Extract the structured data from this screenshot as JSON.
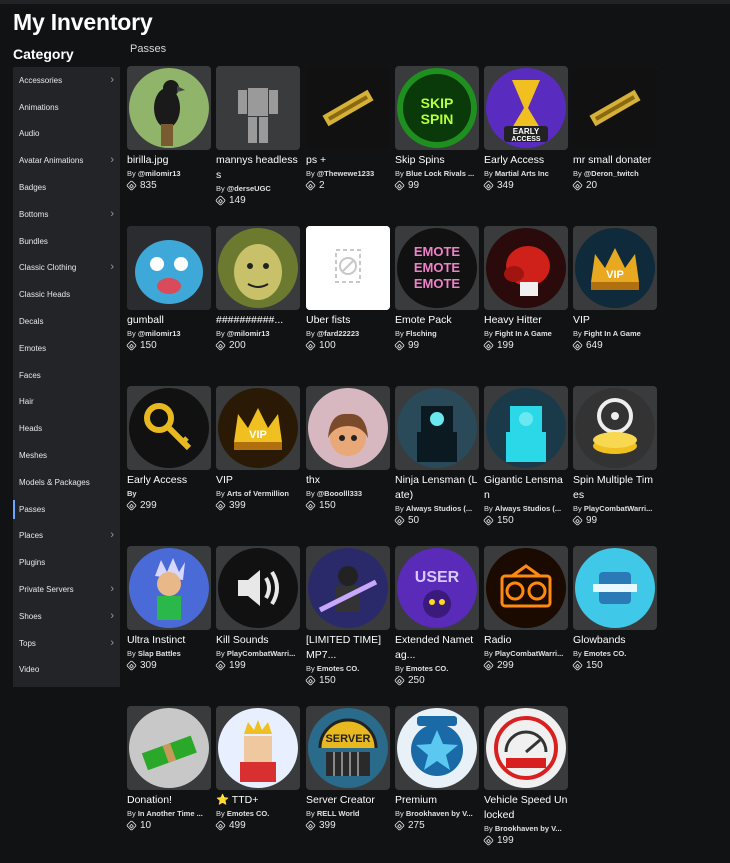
{
  "header": {
    "title": "My Inventory"
  },
  "sidebar": {
    "heading": "Category",
    "items": [
      {
        "label": "Accessories",
        "chevron": true
      },
      {
        "label": "Animations",
        "chevron": false
      },
      {
        "label": "Audio",
        "chevron": false
      },
      {
        "label": "Avatar Animations",
        "chevron": true
      },
      {
        "label": "Badges",
        "chevron": false
      },
      {
        "label": "Bottoms",
        "chevron": true
      },
      {
        "label": "Bundles",
        "chevron": false
      },
      {
        "label": "Classic Clothing",
        "chevron": true
      },
      {
        "label": "Classic Heads",
        "chevron": false
      },
      {
        "label": "Decals",
        "chevron": false
      },
      {
        "label": "Emotes",
        "chevron": false
      },
      {
        "label": "Faces",
        "chevron": false
      },
      {
        "label": "Hair",
        "chevron": false
      },
      {
        "label": "Heads",
        "chevron": false
      },
      {
        "label": "Meshes",
        "chevron": false
      },
      {
        "label": "Models & Packages",
        "chevron": false
      },
      {
        "label": "Passes",
        "chevron": false,
        "active": true
      },
      {
        "label": "Places",
        "chevron": true
      },
      {
        "label": "Plugins",
        "chevron": false
      },
      {
        "label": "Private Servers",
        "chevron": true
      },
      {
        "label": "Shoes",
        "chevron": true
      },
      {
        "label": "Tops",
        "chevron": true
      },
      {
        "label": "Video",
        "chevron": false
      }
    ]
  },
  "main": {
    "section_label": "Passes",
    "items": [
      {
        "name": "birilla.jpg",
        "by": "@milomir13",
        "price": "835",
        "icon": "crow-icon",
        "colors": [
          "#8fb46a",
          "#1a1a1a"
        ]
      },
      {
        "name": "mannys headlesss",
        "by": "@derseUGC",
        "price": "149",
        "icon": "headless-avatar-icon",
        "colors": [
          "#393b3d",
          "#9a9a9a"
        ]
      },
      {
        "name": "ps +",
        "by": "@Thewewe1233",
        "price": "2",
        "icon": "gold-ticket-icon",
        "colors": [
          "#111111",
          "#d6b13a"
        ]
      },
      {
        "name": "Skip Spins",
        "by": "Blue Lock Rivals ...",
        "price": "99",
        "icon": "skip-spin-icon",
        "colors": [
          "#1f8f1f",
          "#b8ff3a"
        ]
      },
      {
        "name": "Early Access",
        "by": "Martial Arts Inc",
        "price": "349",
        "icon": "hourglass-icon",
        "colors": [
          "#5a2bbf",
          "#ffffff"
        ]
      },
      {
        "name": "mr small donater",
        "by": "@Deron_twitch",
        "price": "20",
        "icon": "gold-ticket-icon",
        "colors": [
          "#111111",
          "#d6b13a"
        ]
      },
      {
        "name": "gumball",
        "by": "@milomir13",
        "price": "150",
        "icon": "blue-cat-face-icon",
        "colors": [
          "#3ea8d8",
          "#d94a5a"
        ]
      },
      {
        "name": "##########...",
        "by": "@milomir13",
        "price": "200",
        "icon": "ogre-face-icon",
        "colors": [
          "#6b7a2e",
          "#c9c06a"
        ]
      },
      {
        "name": "Uber fists",
        "by": "@fard22223",
        "price": "100",
        "icon": "missing-image-icon",
        "colors": [
          "#ffffff",
          "#c8c8c8"
        ]
      },
      {
        "name": "Emote Pack",
        "by": "Flsching",
        "price": "99",
        "icon": "emote-text-icon",
        "colors": [
          "#111111",
          "#f080c8"
        ]
      },
      {
        "name": "Heavy Hitter",
        "by": "Fight In A Game",
        "price": "199",
        "icon": "boxing-glove-icon",
        "colors": [
          "#2a0a0a",
          "#d0201a"
        ]
      },
      {
        "name": "VIP",
        "by": "Fight In A Game",
        "price": "649",
        "icon": "vip-crown-icon",
        "colors": [
          "#0f2a3a",
          "#e8a820"
        ]
      },
      {
        "name": "Early Access",
        "by": "By",
        "price": "299",
        "icon": "gold-key-icon",
        "colors": [
          "#111111",
          "#e8b820"
        ]
      },
      {
        "name": "VIP",
        "by": "Arts of Vermillion",
        "price": "399",
        "icon": "vip-crown-icon",
        "colors": [
          "#2a1a05",
          "#f0c020"
        ]
      },
      {
        "name": "thx",
        "by": "@Booolll333",
        "price": "150",
        "icon": "cartoon-girl-icon",
        "colors": [
          "#d8b8c0",
          "#7a4a2a"
        ]
      },
      {
        "name": "Ninja Lensman (Late)",
        "by": "Always Studios (...",
        "price": "50",
        "icon": "robot-icon",
        "colors": [
          "#2a4a5a",
          "#0a1a20"
        ]
      },
      {
        "name": "Gigantic Lensman",
        "by": "Always Studios (...",
        "price": "150",
        "icon": "robot-icon",
        "colors": [
          "#1a3a4a",
          "#2ad8e8"
        ]
      },
      {
        "name": "Spin Multiple Times",
        "by": "PlayCombatWarri...",
        "price": "99",
        "icon": "reel-coins-icon",
        "colors": [
          "#333333",
          "#f0c020"
        ]
      },
      {
        "name": "Ultra Instinct",
        "by": "Slap Battles",
        "price": "309",
        "icon": "anime-hero-icon",
        "colors": [
          "#4a6ad8",
          "#2ab84a"
        ]
      },
      {
        "name": "Kill Sounds",
        "by": "PlayCombatWarri...",
        "price": "199",
        "icon": "speaker-icon",
        "colors": [
          "#111111",
          "#e8e8e8"
        ]
      },
      {
        "name": "[LIMITED TIME] MP7...",
        "by": "Emotes CO.",
        "price": "150",
        "icon": "neon-gun-icon",
        "colors": [
          "#2a2a6a",
          "#c8a8ff"
        ]
      },
      {
        "name": "Extended Nametag...",
        "by": "Emotes CO.",
        "price": "250",
        "icon": "user-badge-icon",
        "colors": [
          "#5a2ab8",
          "#d8c8ff"
        ]
      },
      {
        "name": "Radio",
        "by": "PlayCombatWarri...",
        "price": "299",
        "icon": "radio-icon",
        "colors": [
          "#1a0a00",
          "#ff8a10"
        ]
      },
      {
        "name": "Glowbands",
        "by": "Emotes CO.",
        "price": "150",
        "icon": "glowbands-icon",
        "colors": [
          "#40c8e8",
          "#e8f8ff"
        ]
      },
      {
        "name": "Donation!",
        "by": "In Another Time ...",
        "price": "10",
        "icon": "cash-stack-icon",
        "colors": [
          "#c8c8c8",
          "#2aa82a"
        ]
      },
      {
        "name": "⭐ TTD+",
        "by": "Emotes CO.",
        "price": "499",
        "icon": "crowned-character-icon",
        "colors": [
          "#e8f0ff",
          "#f0c020"
        ]
      },
      {
        "name": "Server Creator",
        "by": "RELL World",
        "price": "399",
        "icon": "server-gate-icon",
        "colors": [
          "#2a6a8a",
          "#e8b820"
        ]
      },
      {
        "name": "Premium",
        "by": "Brookhaven by V...",
        "price": "275",
        "icon": "star-badge-icon",
        "colors": [
          "#e8f0f8",
          "#2a9ad8"
        ]
      },
      {
        "name": "Vehicle Speed Unlocked",
        "by": "Brookhaven by V...",
        "price": "199",
        "icon": "speedometer-icon",
        "colors": [
          "#f0f0f0",
          "#d82020"
        ]
      }
    ]
  }
}
